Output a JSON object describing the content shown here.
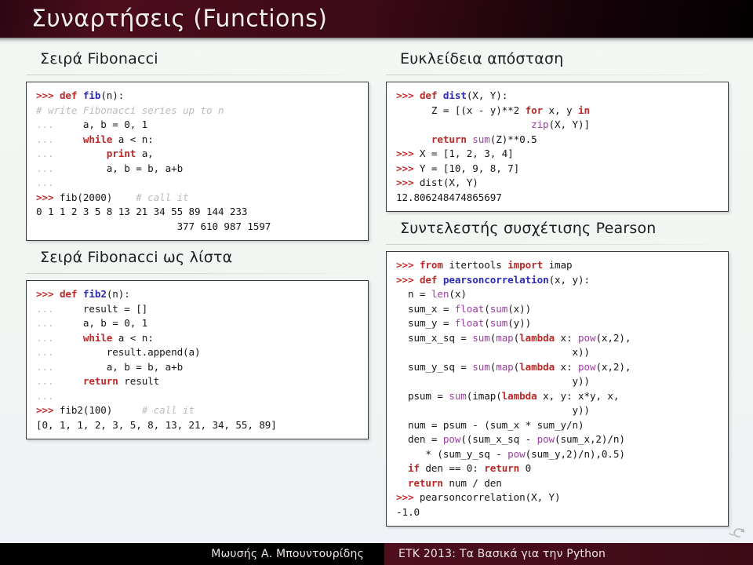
{
  "header": {
    "title": "Συναρτήσεις (Functions)"
  },
  "footer": {
    "author": "Μωυσής Α. Μπουντουρίδης",
    "presentation": "ΕΤΚ 2013: Τα Βασικά για την Python",
    "nav_icon": "circular-arrow-icon",
    "left_bg": "#000000",
    "right_bg": "#460d1b"
  },
  "theme": {
    "header_bg_start": "#4d0d1d",
    "header_bg_end": "#030002",
    "page_bg": "#f2f6f2",
    "code_border": "#3a3a3a",
    "code_bg": "#ffffff",
    "prompt_color": "#c42b2b",
    "keyword_color": "#bb2828",
    "function_color": "#2b2bb5",
    "builtin_color": "#9b3fa0",
    "comment_color": "#b9bcbe"
  },
  "left_column": {
    "sections": [
      {
        "heading": "Σειρά Fibonacci",
        "code_lines": [
          [
            {
              "t": ">>>",
              "c": "prompt"
            },
            {
              "t": " ",
              "c": "plain"
            },
            {
              "t": "def",
              "c": "kw"
            },
            {
              "t": " ",
              "c": "plain"
            },
            {
              "t": "fib",
              "c": "fn"
            },
            {
              "t": "(n):",
              "c": "plain"
            }
          ],
          [
            {
              "t": "# write Fibonacci series up to n",
              "c": "comment"
            }
          ],
          [
            {
              "t": "...",
              "c": "dots"
            },
            {
              "t": "     a, b = 0, 1",
              "c": "plain"
            }
          ],
          [
            {
              "t": "...",
              "c": "dots"
            },
            {
              "t": "     ",
              "c": "plain"
            },
            {
              "t": "while",
              "c": "kw"
            },
            {
              "t": " a < n:",
              "c": "plain"
            }
          ],
          [
            {
              "t": "...",
              "c": "dots"
            },
            {
              "t": "         ",
              "c": "plain"
            },
            {
              "t": "print",
              "c": "kw"
            },
            {
              "t": " a,",
              "c": "plain"
            }
          ],
          [
            {
              "t": "...",
              "c": "dots"
            },
            {
              "t": "         a, b = b, a+b",
              "c": "plain"
            }
          ],
          [
            {
              "t": "...",
              "c": "dots"
            }
          ],
          [
            {
              "t": ">>>",
              "c": "prompt"
            },
            {
              "t": " fib(2000)    ",
              "c": "plain"
            },
            {
              "t": "# call it",
              "c": "comment"
            }
          ],
          [
            {
              "t": "0 1 1 2 3 5 8 13 21 34 55 89 144 233",
              "c": "plain"
            }
          ],
          [
            {
              "t": "                        377 610 987 1597",
              "c": "plain"
            }
          ]
        ]
      },
      {
        "heading": "Σειρά Fibonacci ως λίστα",
        "code_lines": [
          [
            {
              "t": ">>>",
              "c": "prompt"
            },
            {
              "t": " ",
              "c": "plain"
            },
            {
              "t": "def",
              "c": "kw"
            },
            {
              "t": " ",
              "c": "plain"
            },
            {
              "t": "fib2",
              "c": "fn"
            },
            {
              "t": "(n):",
              "c": "plain"
            }
          ],
          [
            {
              "t": "...",
              "c": "dots"
            },
            {
              "t": "     result = []",
              "c": "plain"
            }
          ],
          [
            {
              "t": "...",
              "c": "dots"
            },
            {
              "t": "     a, b = 0, 1",
              "c": "plain"
            }
          ],
          [
            {
              "t": "...",
              "c": "dots"
            },
            {
              "t": "     ",
              "c": "plain"
            },
            {
              "t": "while",
              "c": "kw"
            },
            {
              "t": " a < n:",
              "c": "plain"
            }
          ],
          [
            {
              "t": "...",
              "c": "dots"
            },
            {
              "t": "         result.append(a)",
              "c": "plain"
            }
          ],
          [
            {
              "t": "...",
              "c": "dots"
            },
            {
              "t": "         a, b = b, a+b",
              "c": "plain"
            }
          ],
          [
            {
              "t": "...",
              "c": "dots"
            },
            {
              "t": "     ",
              "c": "plain"
            },
            {
              "t": "return",
              "c": "kw"
            },
            {
              "t": " result",
              "c": "plain"
            }
          ],
          [
            {
              "t": "...",
              "c": "dots"
            }
          ],
          [
            {
              "t": ">>>",
              "c": "prompt"
            },
            {
              "t": " fib2(100)     ",
              "c": "plain"
            },
            {
              "t": "# call it",
              "c": "comment"
            }
          ],
          [
            {
              "t": "[0, 1, 1, 2, 3, 5, 8, 13, 21, 34, 55, 89]",
              "c": "plain"
            }
          ]
        ]
      }
    ]
  },
  "right_column": {
    "sections": [
      {
        "heading": "Ευκλείδεια απόσταση",
        "code_lines": [
          [
            {
              "t": ">>>",
              "c": "prompt"
            },
            {
              "t": " ",
              "c": "plain"
            },
            {
              "t": "def",
              "c": "kw"
            },
            {
              "t": " ",
              "c": "plain"
            },
            {
              "t": "dist",
              "c": "fn"
            },
            {
              "t": "(X, Y):",
              "c": "plain"
            }
          ],
          [
            {
              "t": "      Z = [(x - y)**2 ",
              "c": "plain"
            },
            {
              "t": "for",
              "c": "kw"
            },
            {
              "t": " x, y ",
              "c": "plain"
            },
            {
              "t": "in",
              "c": "kw"
            }
          ],
          [
            {
              "t": "                       ",
              "c": "plain"
            },
            {
              "t": "zip",
              "c": "builtin"
            },
            {
              "t": "(X, Y)]",
              "c": "plain"
            }
          ],
          [
            {
              "t": "      ",
              "c": "plain"
            },
            {
              "t": "return",
              "c": "kw"
            },
            {
              "t": " ",
              "c": "plain"
            },
            {
              "t": "sum",
              "c": "builtin"
            },
            {
              "t": "(Z)**0.5",
              "c": "plain"
            }
          ],
          [
            {
              "t": ">>>",
              "c": "prompt"
            },
            {
              "t": " X = [1, 2, 3, 4]",
              "c": "plain"
            }
          ],
          [
            {
              "t": ">>>",
              "c": "prompt"
            },
            {
              "t": " Y = [10, 9, 8, 7]",
              "c": "plain"
            }
          ],
          [
            {
              "t": ">>>",
              "c": "prompt"
            },
            {
              "t": " dist(X, Y)",
              "c": "plain"
            }
          ],
          [
            {
              "t": "12.806248474865697",
              "c": "plain"
            }
          ]
        ]
      },
      {
        "heading": "Συντελεστής συσχέτισης Pearson",
        "code_lines": [
          [
            {
              "t": ">>>",
              "c": "prompt"
            },
            {
              "t": " ",
              "c": "plain"
            },
            {
              "t": "from",
              "c": "kw"
            },
            {
              "t": " itertools ",
              "c": "plain"
            },
            {
              "t": "import",
              "c": "kw"
            },
            {
              "t": " imap",
              "c": "plain"
            }
          ],
          [
            {
              "t": ">>>",
              "c": "prompt"
            },
            {
              "t": " ",
              "c": "plain"
            },
            {
              "t": "def",
              "c": "kw"
            },
            {
              "t": " ",
              "c": "plain"
            },
            {
              "t": "pearsoncorrelation",
              "c": "fn"
            },
            {
              "t": "(x, y):",
              "c": "plain"
            }
          ],
          [
            {
              "t": "  n = ",
              "c": "plain"
            },
            {
              "t": "len",
              "c": "builtin"
            },
            {
              "t": "(x)",
              "c": "plain"
            }
          ],
          [
            {
              "t": "  sum_x = ",
              "c": "plain"
            },
            {
              "t": "float",
              "c": "builtin"
            },
            {
              "t": "(",
              "c": "plain"
            },
            {
              "t": "sum",
              "c": "builtin"
            },
            {
              "t": "(x))",
              "c": "plain"
            }
          ],
          [
            {
              "t": "  sum_y = ",
              "c": "plain"
            },
            {
              "t": "float",
              "c": "builtin"
            },
            {
              "t": "(",
              "c": "plain"
            },
            {
              "t": "sum",
              "c": "builtin"
            },
            {
              "t": "(y))",
              "c": "plain"
            }
          ],
          [
            {
              "t": "  sum_x_sq = ",
              "c": "plain"
            },
            {
              "t": "sum",
              "c": "builtin"
            },
            {
              "t": "(",
              "c": "plain"
            },
            {
              "t": "map",
              "c": "builtin"
            },
            {
              "t": "(",
              "c": "plain"
            },
            {
              "t": "lambda",
              "c": "kw"
            },
            {
              "t": " x: ",
              "c": "plain"
            },
            {
              "t": "pow",
              "c": "builtin"
            },
            {
              "t": "(x,2),",
              "c": "plain"
            }
          ],
          [
            {
              "t": "                              x))",
              "c": "plain"
            }
          ],
          [
            {
              "t": "  sum_y_sq = ",
              "c": "plain"
            },
            {
              "t": "sum",
              "c": "builtin"
            },
            {
              "t": "(",
              "c": "plain"
            },
            {
              "t": "map",
              "c": "builtin"
            },
            {
              "t": "(",
              "c": "plain"
            },
            {
              "t": "lambda",
              "c": "kw"
            },
            {
              "t": " x: ",
              "c": "plain"
            },
            {
              "t": "pow",
              "c": "builtin"
            },
            {
              "t": "(x,2),",
              "c": "plain"
            }
          ],
          [
            {
              "t": "                              y))",
              "c": "plain"
            }
          ],
          [
            {
              "t": "  psum = ",
              "c": "plain"
            },
            {
              "t": "sum",
              "c": "builtin"
            },
            {
              "t": "(imap(",
              "c": "plain"
            },
            {
              "t": "lambda",
              "c": "kw"
            },
            {
              "t": " x, y: x*y, x,",
              "c": "plain"
            }
          ],
          [
            {
              "t": "                              y))",
              "c": "plain"
            }
          ],
          [
            {
              "t": "  num = psum - (sum_x * sum_y/n)",
              "c": "plain"
            }
          ],
          [
            {
              "t": "  den = ",
              "c": "plain"
            },
            {
              "t": "pow",
              "c": "builtin"
            },
            {
              "t": "((sum_x_sq - ",
              "c": "plain"
            },
            {
              "t": "pow",
              "c": "builtin"
            },
            {
              "t": "(sum_x,2)/n)",
              "c": "plain"
            }
          ],
          [
            {
              "t": "     * (sum_y_sq - ",
              "c": "plain"
            },
            {
              "t": "pow",
              "c": "builtin"
            },
            {
              "t": "(sum_y,2)/n),0.5)",
              "c": "plain"
            }
          ],
          [
            {
              "t": "  ",
              "c": "plain"
            },
            {
              "t": "if",
              "c": "kw"
            },
            {
              "t": " den == 0: ",
              "c": "plain"
            },
            {
              "t": "return",
              "c": "kw"
            },
            {
              "t": " 0",
              "c": "plain"
            }
          ],
          [
            {
              "t": "  ",
              "c": "plain"
            },
            {
              "t": "return",
              "c": "kw"
            },
            {
              "t": " num / den",
              "c": "plain"
            }
          ],
          [
            {
              "t": ">>>",
              "c": "prompt"
            },
            {
              "t": " pearsoncorrelation(X, Y)",
              "c": "plain"
            }
          ],
          [
            {
              "t": "-1.0",
              "c": "plain"
            }
          ]
        ]
      }
    ]
  }
}
